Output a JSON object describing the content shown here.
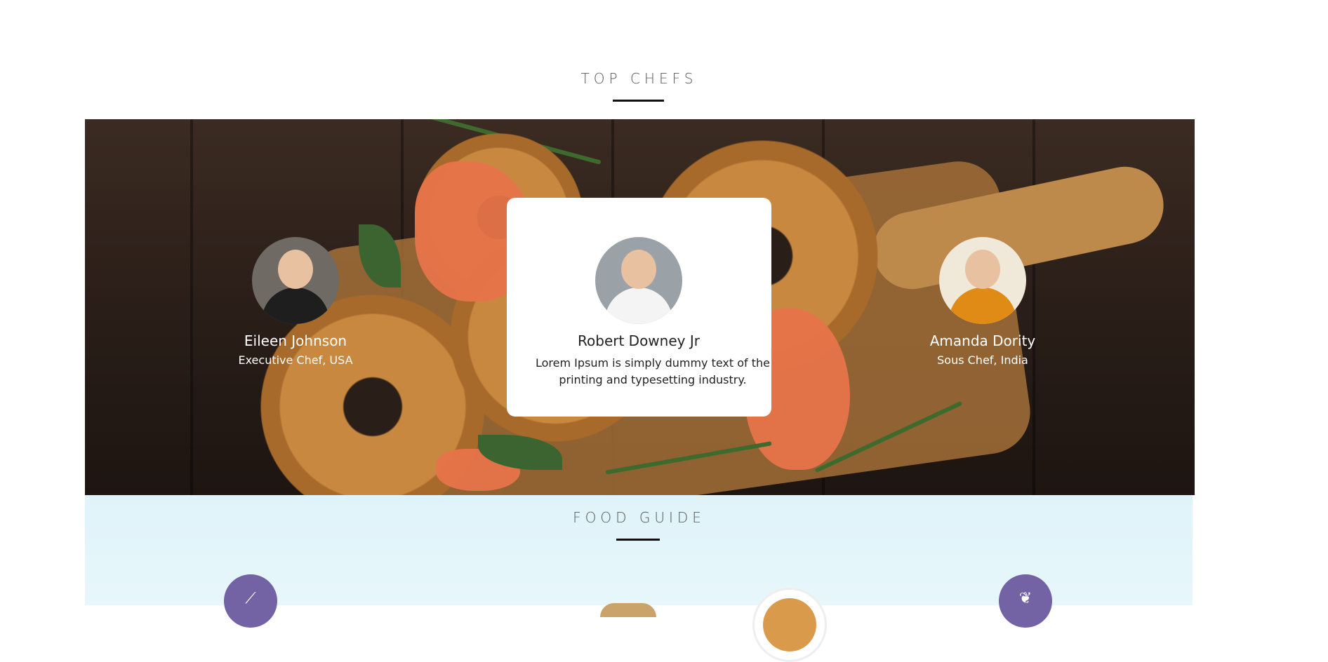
{
  "sections": {
    "top_chefs": {
      "title": "TOP CHEFS"
    },
    "food_guide": {
      "title": "FOOD GUIDE"
    }
  },
  "chefs": [
    {
      "name": "Eileen Johnson",
      "role": "Executive Chef, USA"
    },
    {
      "name": "Robert Downey Jr",
      "description": "Lorem Ipsum is simply dummy text of the printing and typesetting industry."
    },
    {
      "name": "Amanda Dority",
      "role": "Sous Chef, India"
    }
  ],
  "icons": {
    "guide_left": "carrot-icon",
    "guide_right": "wheat-icon"
  },
  "colors": {
    "accent": "#7362a4",
    "guide_background": "#dff3f9"
  }
}
